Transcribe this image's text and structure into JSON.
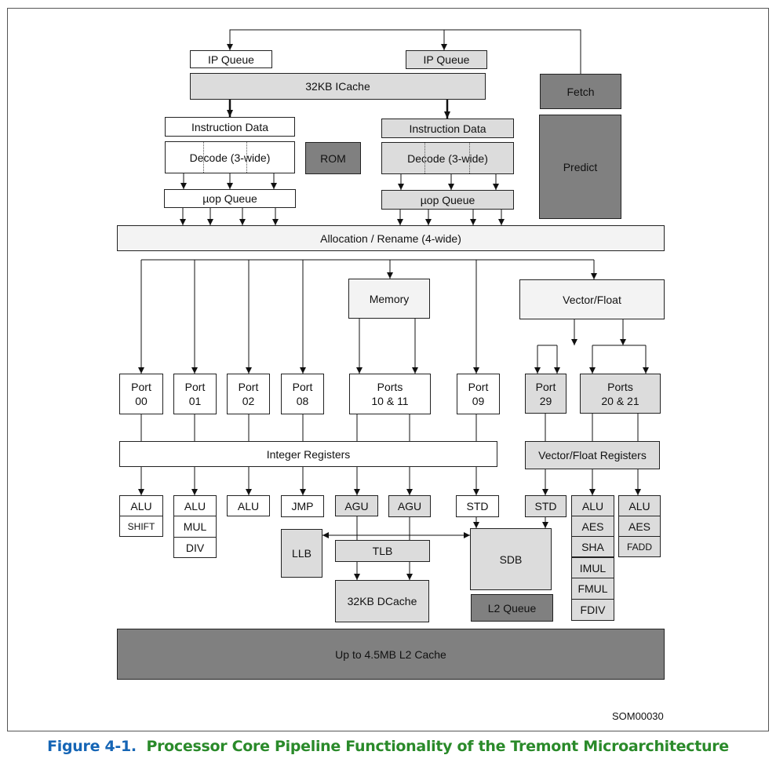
{
  "front_end": {
    "ip_queue_left": "IP Queue",
    "ip_queue_right": "IP Queue",
    "icache": "32KB ICache",
    "fetch": "Fetch",
    "predict": "Predict",
    "instr_data_left": "Instruction Data",
    "instr_data_right": "Instruction Data",
    "decode_left": "Decode (3-wide)",
    "decode_right": "Decode (3-wide)",
    "rom": "ROM",
    "uop_queue_left": "µop Queue",
    "uop_queue_right": "µop Queue"
  },
  "allocation": "Allocation / Rename (4-wide)",
  "memory": "Memory",
  "vector_float": "Vector/Float",
  "ports": [
    "Port\n00",
    "Port\n01",
    "Port\n02",
    "Port\n08",
    "Ports\n10 & 11",
    "Port\n09",
    "Port\n29",
    "Ports\n20 & 21"
  ],
  "integer_registers": "Integer Registers",
  "vf_registers": "Vector/Float Registers",
  "units": {
    "p00": [
      "ALU",
      "SHIFT"
    ],
    "p01": [
      "ALU",
      "MUL",
      "DIV"
    ],
    "p02": "ALU",
    "p08": "JMP",
    "agu1": "AGU",
    "agu2": "AGU",
    "std1": "STD",
    "std2": "STD",
    "p20": [
      "ALU",
      "AES",
      "SHA",
      "IMUL",
      "FMUL",
      "FDIV"
    ],
    "p21": [
      "ALU",
      "AES",
      "FADD"
    ]
  },
  "memory_units": {
    "llb": "LLB",
    "tlb": "TLB",
    "dcache": "32KB DCache",
    "sdb": "SDB",
    "l2_queue": "L2 Queue"
  },
  "l2_cache": "Up to 4.5MB L2 Cache",
  "figure_id": "SOM00030",
  "caption": {
    "number": "Figure 4-1.",
    "title": "Processor Core Pipeline Functionality of the Tremont Microarchitecture"
  },
  "colors": {
    "white": "#ffffff",
    "light_gray": "#dcdcdc",
    "dark_gray": "#808080",
    "caption_blue": "#1565b5",
    "caption_green": "#2a8a2a"
  }
}
